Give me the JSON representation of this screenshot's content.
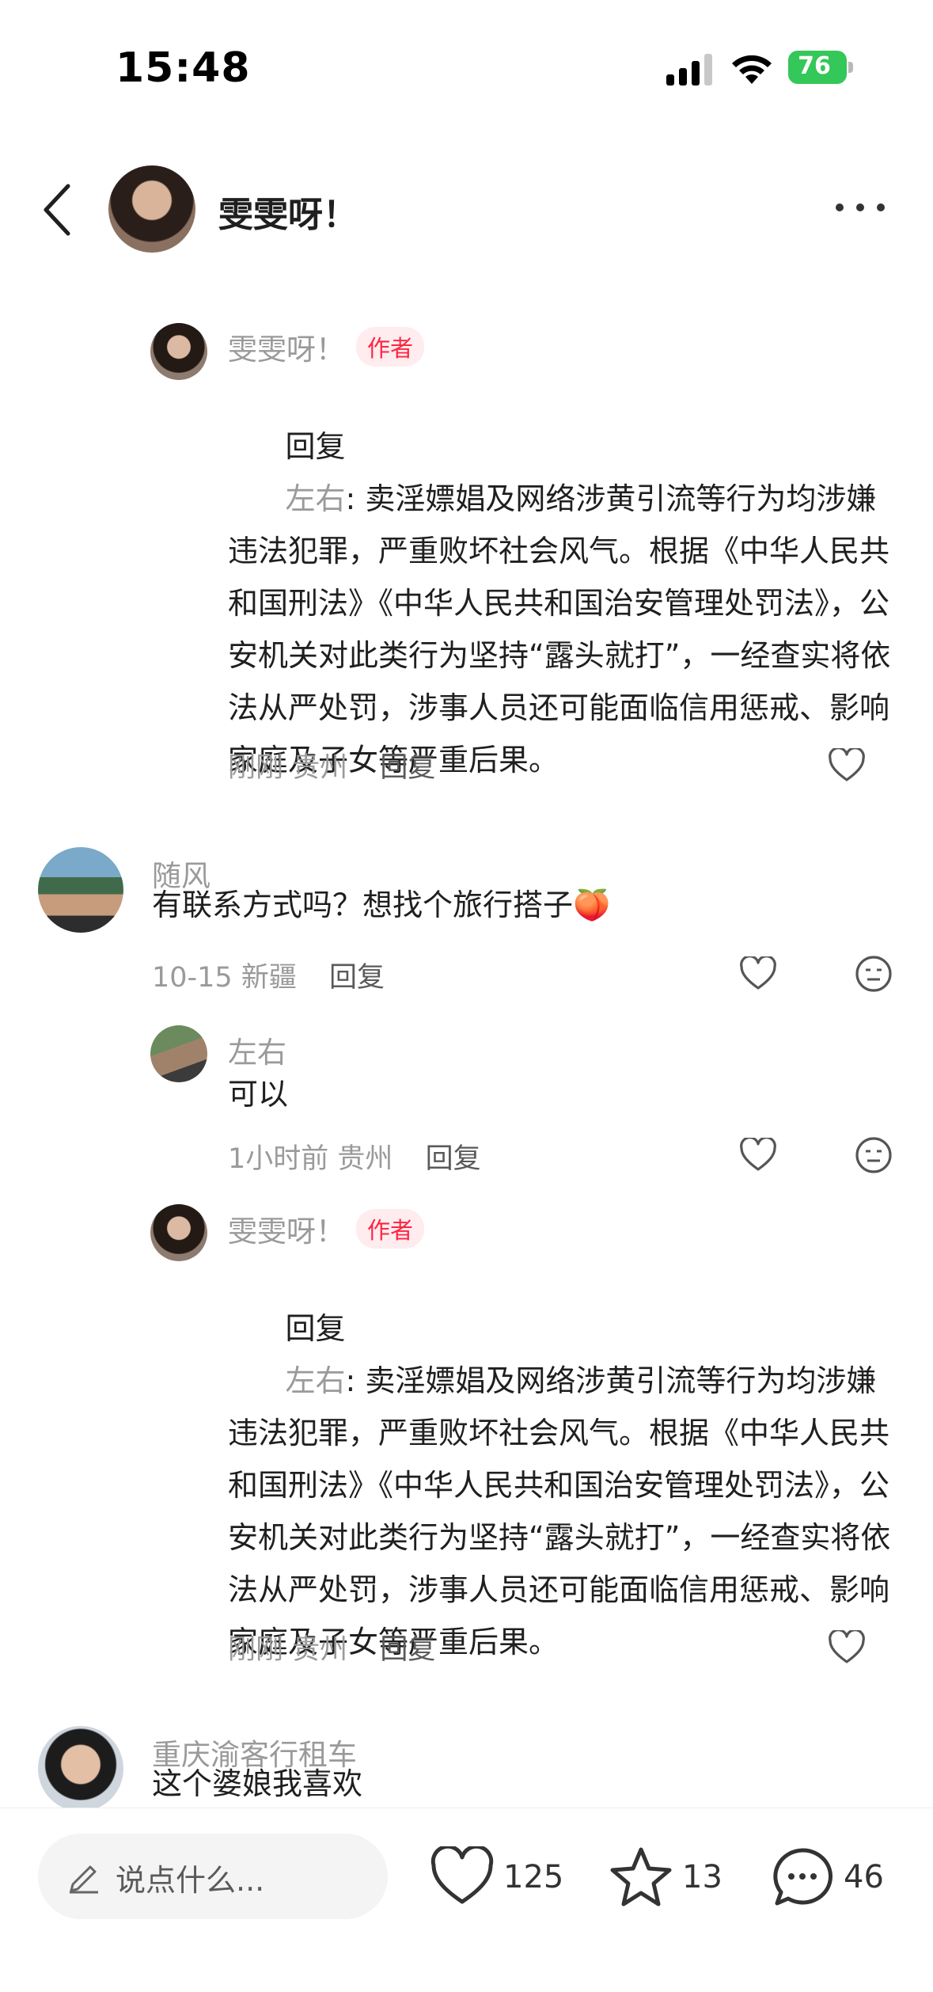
{
  "status_bar": {
    "time": "15:48",
    "battery": "76"
  },
  "header": {
    "title": "雯雯呀！"
  },
  "comments": [
    {
      "name": "雯雯呀！",
      "badge": "作者",
      "reply_prefix": "回复",
      "reply_target": "左右",
      "text": ": 卖淫嫖娼及网络涉黄引流等行为均涉嫌违法犯罪，严重败坏社会风气。根据《中华人民共和国刑法》《中华人民共和国治安管理处罚法》，公安机关对此类行为坚持“露头就打”，一经查实将依法从严处罚，涉事人员还可能面临信用惩戒、影响家庭及子女等严重后果。",
      "time": "刚刚",
      "location": "贵州",
      "reply_label": "回复"
    },
    {
      "name": "随风",
      "text": "有联系方式吗？想找个旅行搭子🍑",
      "time": "10-15",
      "location": "新疆",
      "reply_label": "回复"
    },
    {
      "name": "左右",
      "text": "可以",
      "time": "1小时前",
      "location": "贵州",
      "reply_label": "回复"
    },
    {
      "name": "雯雯呀！",
      "badge": "作者",
      "reply_prefix": "回复",
      "reply_target": "左右",
      "text": ": 卖淫嫖娼及网络涉黄引流等行为均涉嫌违法犯罪，严重败坏社会风气。根据《中华人民共和国刑法》《中华人民共和国治安管理处罚法》，公安机关对此类行为坚持“露头就打”，一经查实将依法从严处罚，涉事人员还可能面临信用惩戒、影响家庭及子女等严重后果。",
      "time": "刚刚",
      "location": "贵州",
      "reply_label": "回复"
    },
    {
      "name": "重庆渝客行租车",
      "text": "这个婆娘我喜欢"
    }
  ],
  "bottom_bar": {
    "input_placeholder": "说点什么...",
    "likes": "125",
    "favorites": "13",
    "comments": "46"
  },
  "colors": {
    "accent": "#ff2442",
    "muted": "#9a9a9a",
    "battery": "#34c759"
  },
  "icons": [
    "back-icon",
    "more-icon",
    "heart-icon",
    "dislike-icon",
    "pencil-icon",
    "star-icon",
    "chat-icon",
    "signal-icon",
    "wifi-icon",
    "battery-icon"
  ]
}
